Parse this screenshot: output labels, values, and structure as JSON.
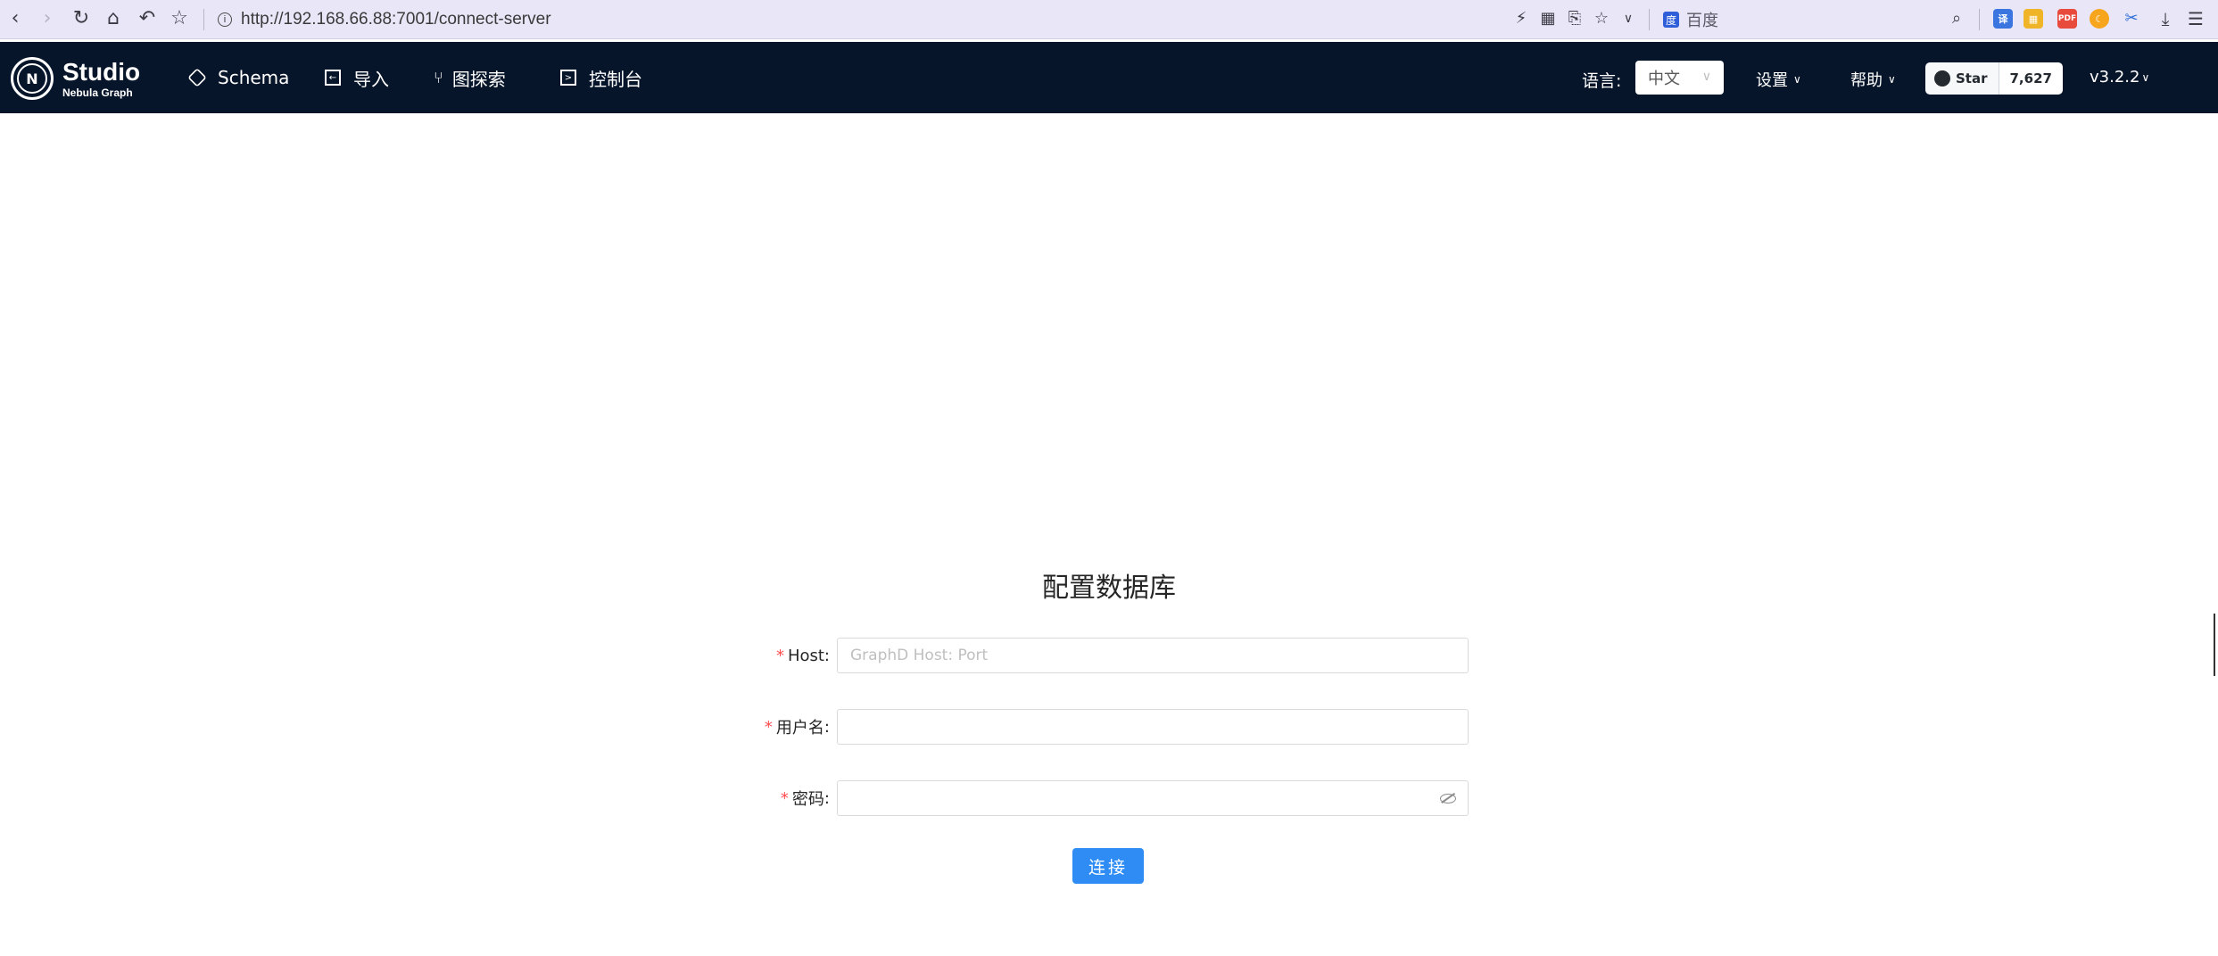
{
  "browser": {
    "url": "http://192.168.66.88:7001/connect-server",
    "search_engine": "百度",
    "nav_icons": [
      "back-icon",
      "forward-icon",
      "reload-icon",
      "home-icon",
      "undo-icon",
      "bookmark-star-icon"
    ],
    "ext_pdf_label": "PDF"
  },
  "navbar": {
    "logo_title": "Studio",
    "logo_subtitle": "Nebula Graph",
    "items": [
      {
        "label": "Schema",
        "icon": "hexagon-icon"
      },
      {
        "label": "导入",
        "icon": "import-icon"
      },
      {
        "label": "图探索",
        "icon": "branch-icon"
      },
      {
        "label": "控制台",
        "icon": "terminal-icon"
      }
    ],
    "language_label": "语言:",
    "language_value": "中文",
    "settings_label": "设置",
    "help_label": "帮助",
    "github_star_label": "Star",
    "github_star_count": "7,627",
    "version": "v3.2.2"
  },
  "form": {
    "title": "配置数据库",
    "host_label": "Host",
    "host_placeholder": "GraphD Host: Port",
    "host_value": "",
    "username_label": "用户名",
    "username_value": "",
    "password_label": "密码",
    "password_value": "",
    "required_mark": "*",
    "colon": ":",
    "connect_button": "连接"
  },
  "colors": {
    "browser_bar": "#e9e6f7",
    "navbar_bg": "#07152a",
    "primary": "#2f8cf4",
    "required": "#ff4d4f"
  }
}
